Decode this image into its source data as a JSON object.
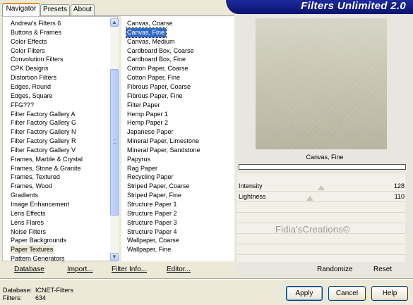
{
  "tabs": [
    "Navigator",
    "Presets",
    "About"
  ],
  "title": "Filters Unlimited 2.0",
  "categories": [
    "Andrew's Filters 6",
    "Buttons & Frames",
    "Color Effects",
    "Color Filters",
    "Convolution Filters",
    "CPK Designs",
    "Distortion Filters",
    "Edges, Round",
    "Edges, Square",
    "FFG???",
    "Filter Factory Gallery A",
    "Filter Factory Gallery G",
    "Filter Factory Gallery N",
    "Filter Factory Gallery R",
    "Filter Factory Gallery V",
    "Frames, Marble & Crystal",
    "Frames, Stone & Granite",
    "Frames, Textured",
    "Frames, Wood",
    "Gradients",
    "Image Enhancement",
    "Lens Effects",
    "Lens Flares",
    "Noise Filters",
    "Paper Backgrounds",
    "Paper Textures",
    "Pattern Generators"
  ],
  "selected_category": "Paper Textures",
  "filters": [
    "Canvas, Coarse",
    "Canvas, Fine",
    "Canvas, Medium",
    "Cardboard Box, Coarse",
    "Cardboard Box, Fine",
    "Cotton Paper, Coarse",
    "Cotton Paper, Fine",
    "Fibrous Paper, Coarse",
    "Fibrous Paper, Fine",
    "Filter Paper",
    "Hemp Paper 1",
    "Hemp Paper 2",
    "Japanese Paper",
    "Mineral Paper, Limestone",
    "Mineral Paper, Sandstone",
    "Papyrus",
    "Rag Paper",
    "Recycling Paper",
    "Striped Paper, Coarse",
    "Striped Paper, Fine",
    "Structure Paper 1",
    "Structure Paper 2",
    "Structure Paper 3",
    "Structure Paper 4",
    "Wallpaper, Coarse",
    "Wallpaper, Fine"
  ],
  "selected_filter": "Canvas, Fine",
  "preview_filter_name": "Canvas, Fine",
  "sliders": [
    {
      "label": "Intensity",
      "value": "128",
      "level": 0.5
    },
    {
      "label": "Lightness",
      "value": "110",
      "level": 0.43
    }
  ],
  "watermark": "Fidia'sCreations©",
  "bottom_links": {
    "database": "Database",
    "import": "Import...",
    "filter_info": "Filter Info...",
    "editor": "Editor...",
    "randomize": "Randomize",
    "reset": "Reset"
  },
  "info": {
    "database_label": "Database:",
    "database_value": "ICNET-Filters",
    "filters_label": "Filters:",
    "filters_value": "634"
  },
  "buttons": {
    "apply": "Apply",
    "cancel": "Cancel",
    "help": "Help"
  },
  "colors": {
    "selection": "#316ac5",
    "banner": "#0a1370",
    "tab_accent": "#e68b2c"
  }
}
